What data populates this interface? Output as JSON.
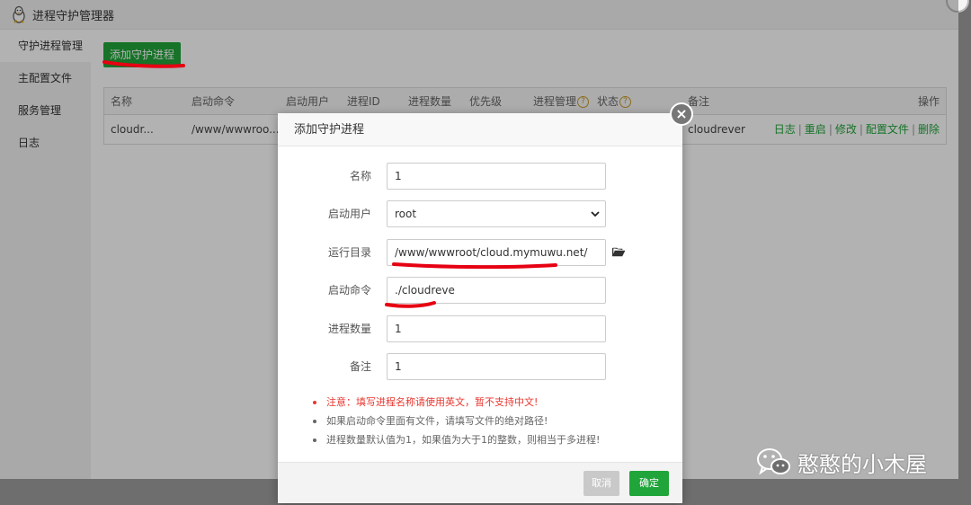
{
  "window": {
    "title": "进程守护管理器"
  },
  "sidebar": {
    "items": [
      {
        "label": "守护进程管理",
        "active": true
      },
      {
        "label": "主配置文件",
        "active": false
      },
      {
        "label": "服务管理",
        "active": false
      },
      {
        "label": "日志",
        "active": false
      }
    ]
  },
  "main": {
    "add_button": "添加守护进程",
    "table": {
      "headers": [
        "名称",
        "启动命令",
        "启动用户",
        "进程ID",
        "进程数量",
        "优先级",
        "进程管理",
        "状态",
        "备注",
        "操作"
      ],
      "help_glyph": "?",
      "rows": [
        {
          "name": "cloudr...",
          "command": "/www/wwwroo...",
          "remark": "cloudrever",
          "ops": [
            "日志",
            "重启",
            "修改",
            "配置文件",
            "删除"
          ]
        }
      ],
      "ops_separator": "|"
    }
  },
  "modal": {
    "title": "添加守护进程",
    "close_glyph": "×",
    "fields": {
      "name": {
        "label": "名称",
        "value": "1"
      },
      "user": {
        "label": "启动用户",
        "value": "root"
      },
      "dir": {
        "label": "运行目录",
        "value": "/www/wwwroot/cloud.mymuwu.net/"
      },
      "command": {
        "label": "启动命令",
        "value": "./cloudreve"
      },
      "count": {
        "label": "进程数量",
        "value": "1"
      },
      "remark": {
        "label": "备注",
        "value": "1"
      }
    },
    "notes": [
      {
        "text": "注意：填写进程名称请使用英文，暂不支持中文!",
        "warn": true
      },
      {
        "text": "如果启动命令里面有文件，请填写文件的绝对路径!",
        "warn": false
      },
      {
        "text": "进程数量默认值为1，如果值为大于1的整数，则相当于多进程!",
        "warn": false
      }
    ],
    "cancel_label": "取消",
    "ok_label": "确定"
  },
  "watermark": {
    "text": "憨憨的小木屋",
    "icon": "wechat-icon"
  },
  "colors": {
    "accent": "#20a53a",
    "warning": "#e8372f",
    "annotation": "#e60012",
    "help": "#c89b2a"
  }
}
